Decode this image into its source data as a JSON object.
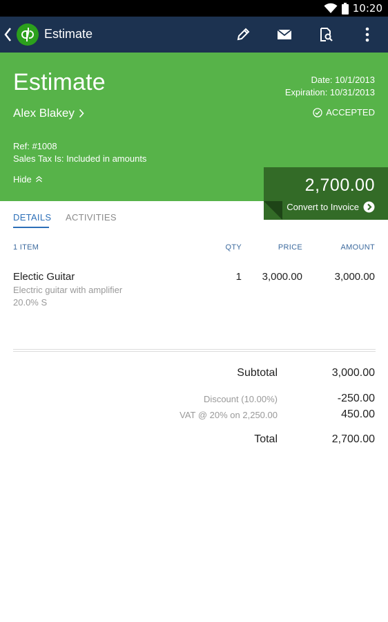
{
  "status_bar": {
    "time": "10:20"
  },
  "app_bar": {
    "title": "Estimate",
    "logo_text": "qb"
  },
  "header": {
    "title": "Estimate",
    "customer": "Alex Blakey",
    "date": "Date: 10/1/2013",
    "expiration": "Expiration: 10/31/2013",
    "status": "ACCEPTED",
    "ref": "Ref: #1008",
    "sales_tax": "Sales Tax Is: Included in amounts",
    "hide_label": "Hide"
  },
  "total_box": {
    "amount": "2,700.00",
    "convert_label": "Convert to Invoice"
  },
  "tabs": [
    {
      "label": "DETAILS"
    },
    {
      "label": "ACTIVITIES"
    }
  ],
  "table": {
    "headers": {
      "count": "1  ITEM",
      "qty": "QTY",
      "price": "PRICE",
      "amount": "AMOUNT"
    },
    "items": [
      {
        "name": "Electic Guitar",
        "description": "Electric guitar with amplifier",
        "tax": "20.0% S",
        "qty": "1",
        "price": "3,000.00",
        "amount": "3,000.00"
      }
    ]
  },
  "summary": {
    "subtotal_label": "Subtotal",
    "subtotal_value": "3,000.00",
    "discount_label": "Discount (10.00%)",
    "discount_value": "-250.00",
    "vat_label": "VAT @ 20% on 2,250.00",
    "vat_value": "450.00",
    "total_label": "Total",
    "total_value": "2,700.00"
  },
  "colors": {
    "app_bar": "#1c3250",
    "header_green": "#57b349",
    "total_green": "#336b27",
    "accent_blue": "#2c6fb8"
  },
  "icons": {
    "back": "chevron-left-icon",
    "logo": "quickbooks-logo",
    "edit": "pencil-icon",
    "email": "envelope-icon",
    "preview": "document-search-icon",
    "menu": "overflow-menu-icon",
    "customer_link": "chevron-right-icon",
    "accepted": "check-circle-icon",
    "hide": "chevron-up-icon",
    "convert": "arrow-circle-right-icon"
  }
}
